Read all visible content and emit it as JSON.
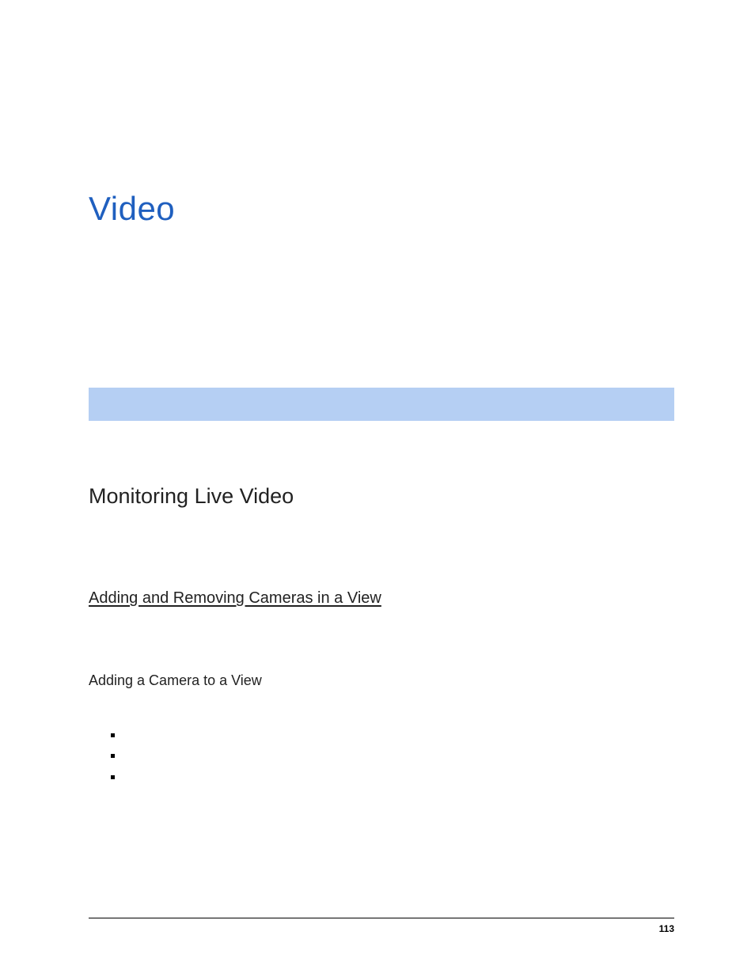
{
  "chapter": {
    "title": "Video"
  },
  "section": {
    "title": "Monitoring Live Video",
    "intro": " "
  },
  "subsection": {
    "title": "Adding and Removing Cameras in a View",
    "intro": " "
  },
  "h3": {
    "title": "Adding a Camera to a View",
    "intro": " "
  },
  "bullets": [
    " ",
    " ",
    " "
  ],
  "tail": " ",
  "footer": {
    "page": "113"
  }
}
